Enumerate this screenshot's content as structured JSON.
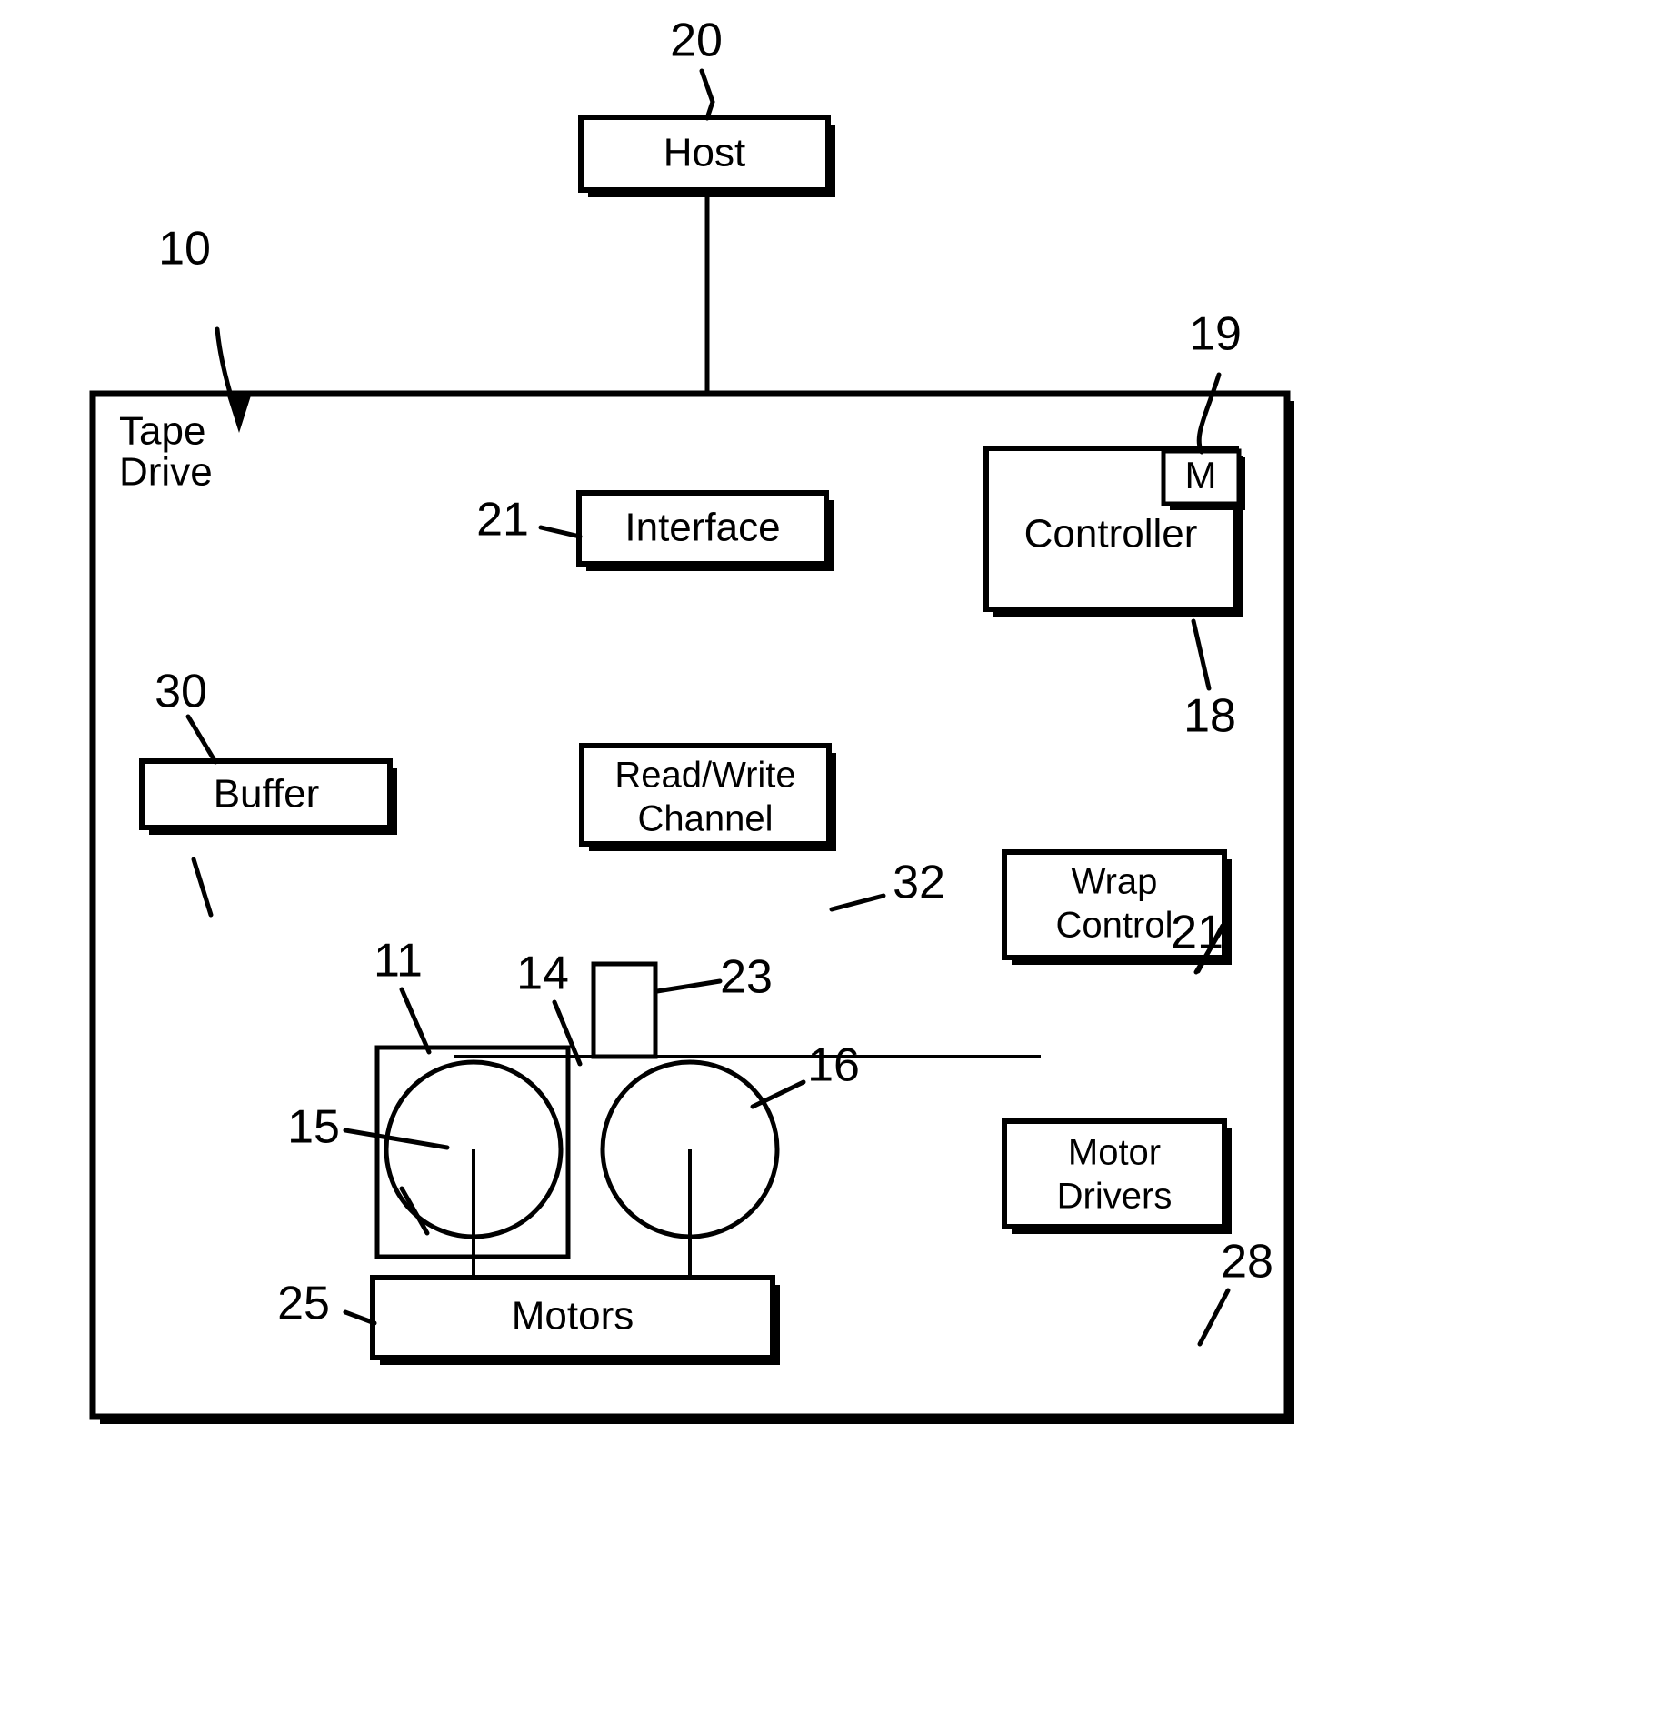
{
  "figure": {
    "type": "patent-block-diagram",
    "title_text": "",
    "background": "#ffffff",
    "ink": "#000000"
  },
  "enclosure": {
    "name": "tape-drive",
    "label_line1": "Tape",
    "label_line2": "Drive",
    "ref": "10"
  },
  "blocks": {
    "host": {
      "label": "Host",
      "ref": "20"
    },
    "interface": {
      "label": "Interface",
      "ref": "21"
    },
    "controller": {
      "label": "Controller",
      "ref": "18",
      "memory_label": "M",
      "memory_ref": "19"
    },
    "buffer": {
      "label": "Buffer",
      "ref": "30"
    },
    "read_write_channel": {
      "label_line1": "Read/Write",
      "label_line2": "Channel",
      "ref": "32"
    },
    "wrap_control": {
      "label_line1": "Wrap",
      "label_line2": "Control",
      "ref": "21"
    },
    "motor_drivers": {
      "label_line1": "Motor",
      "label_line2": "Drivers",
      "ref": "28"
    },
    "motors": {
      "label": "Motors",
      "ref": "25"
    },
    "head": {
      "label": "",
      "ref": "23"
    },
    "cartridge": {
      "label": "",
      "ref": "11"
    },
    "tape": {
      "label": "",
      "ref": "14"
    },
    "supply_reel": {
      "label": "",
      "ref": "15"
    },
    "takeup_reel": {
      "label": "",
      "ref": "16"
    }
  },
  "reference_numerals": [
    {
      "id": "10",
      "text": "10",
      "describes": "tape drive enclosure"
    },
    {
      "id": "11",
      "text": "11",
      "describes": "cartridge"
    },
    {
      "id": "14",
      "text": "14",
      "describes": "tape"
    },
    {
      "id": "15",
      "text": "15",
      "describes": "supply reel"
    },
    {
      "id": "16",
      "text": "16",
      "describes": "take-up reel"
    },
    {
      "id": "18",
      "text": "18",
      "describes": "controller"
    },
    {
      "id": "19",
      "text": "19",
      "describes": "memory"
    },
    {
      "id": "20",
      "text": "20",
      "describes": "host"
    },
    {
      "id": "21a",
      "text": "21",
      "describes": "interface"
    },
    {
      "id": "21b",
      "text": "21",
      "describes": "wrap control"
    },
    {
      "id": "23",
      "text": "23",
      "describes": "head"
    },
    {
      "id": "25",
      "text": "25",
      "describes": "motors"
    },
    {
      "id": "28",
      "text": "28",
      "describes": "motor drivers"
    },
    {
      "id": "30",
      "text": "30",
      "describes": "buffer"
    },
    {
      "id": "32",
      "text": "32",
      "describes": "read/write channel"
    }
  ]
}
